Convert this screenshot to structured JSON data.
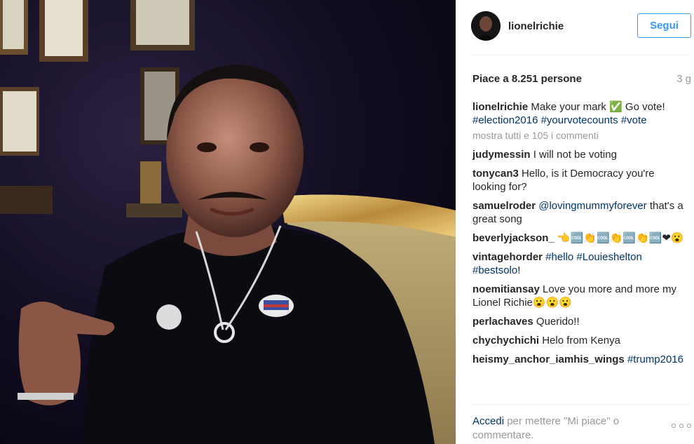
{
  "post": {
    "photo_alt": "photo",
    "author": {
      "username": "lionelrichie",
      "follow_label": "Segui"
    },
    "likes_text": "Piace a 8.251 persone",
    "time_ago": "3 g",
    "caption": {
      "author": "lionelrichie",
      "text": "Make your mark ✅ Go vote!",
      "tags": [
        "#election2016",
        "#yourvotecounts",
        "#vote"
      ]
    },
    "show_all_label": "mostra tutti e 105 i commenti",
    "comments": [
      {
        "author": "judymessin",
        "text": "I will not be voting"
      },
      {
        "author": "tonycan3",
        "text": "Hello, is it Democracy you're looking for?"
      },
      {
        "author": "samuelroder",
        "mention": "@lovingmummyforever",
        "text": "that's a great song"
      },
      {
        "author": "beverlyjackson_",
        "text": "👈🆒👏🆒👏🆒👏🆒❤😮"
      },
      {
        "author": "vintagehorder",
        "mention": "#hello #Louieshelton",
        "tag2": "#bestsolo",
        "text": "!"
      },
      {
        "author": "noemitiansay",
        "text": "Love you more and more my Lionel Richie😮😮😮"
      },
      {
        "author": "perlachaves",
        "text": "Querido!!"
      },
      {
        "author": "chychychichi",
        "text": "Helo from Kenya"
      },
      {
        "author": "heismy_anchor_iamhis_wings",
        "mention": "#trump2016",
        "text": ""
      }
    ],
    "footer": {
      "login_label": "Accedi",
      "rest": "per mettere \"Mi piace\" o commentare."
    }
  },
  "colors": {
    "accent": "#3897f0",
    "link": "#003569",
    "muted": "#999999"
  },
  "icons": {
    "more": "more-options-icon"
  }
}
